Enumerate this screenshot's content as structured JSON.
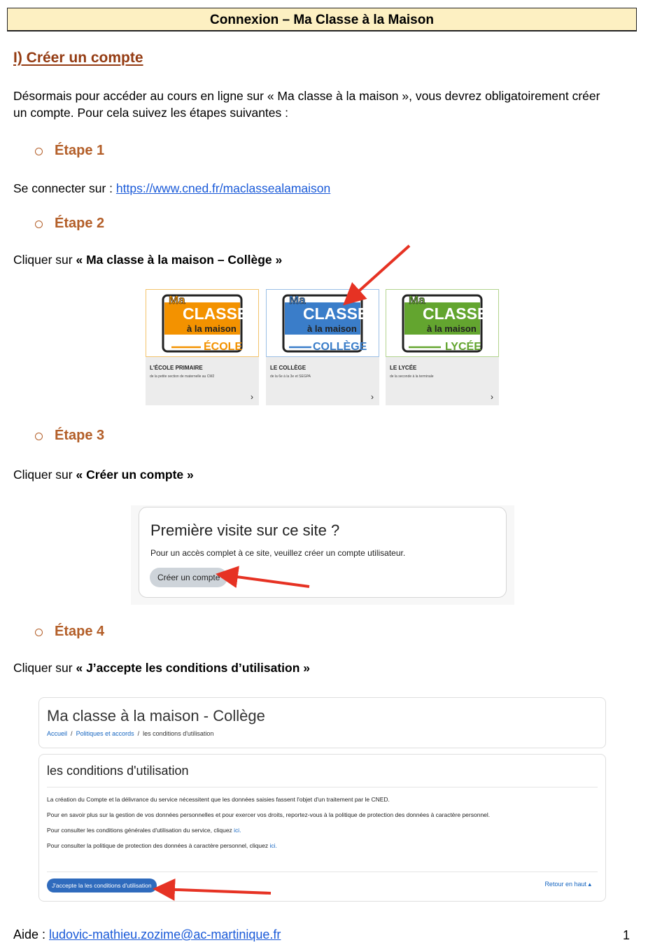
{
  "header": {
    "title": "Connexion – Ma Classe à la Maison"
  },
  "section": {
    "title": "I) Créer un compte"
  },
  "intro": {
    "line1": "Désormais pour accéder au cours en ligne sur « Ma classe à la maison », vous devrez obligatoirement créer",
    "line2": "un compte. Pour cela suivez les étapes suivantes :"
  },
  "steps": [
    {
      "label": "Étape 1"
    },
    {
      "label": "Étape 2"
    },
    {
      "label": "Étape 3"
    },
    {
      "label": "Étape 4"
    }
  ],
  "step1": {
    "prefix": "Se connecter sur : ",
    "url": "https://www.cned.fr/maclassealamaison"
  },
  "step2": {
    "prefix": "Cliquer sur ",
    "bold": "« Ma classe à la maison – Collège »"
  },
  "step3": {
    "prefix": "Cliquer sur ",
    "bold": "« Créer un compte »"
  },
  "step4": {
    "prefix": "Cliquer sur ",
    "bold": "« J’accepte les conditions d’utilisation »"
  },
  "cards": [
    {
      "logo_top": "Ma",
      "logo_mid": "CLASSE",
      "logo_small": "à la maison",
      "level": "ÉCOLE",
      "title": "L'ÉCOLE PRIMAIRE",
      "subtitle": "de la petite section de maternelle au CM2",
      "color": "#f39200",
      "border": "#f3c46c"
    },
    {
      "logo_top": "Ma",
      "logo_mid": "CLASSE",
      "logo_small": "à la maison",
      "level": "COLLÈGE",
      "title": "LE COLLÈGE",
      "subtitle": "de la 6e à la 3e et SEGPA",
      "color": "#3a7dc9",
      "border": "#9cc0e6"
    },
    {
      "logo_top": "Ma",
      "logo_mid": "CLASSE",
      "logo_small": "à la maison",
      "level": "LYCÉE",
      "title": "LE LYCÉE",
      "subtitle": "de la seconde à la terminale",
      "color": "#63a52f",
      "border": "#b3d48e"
    }
  ],
  "visit": {
    "title": "Première visite sur ce site ?",
    "text": "Pour un accès complet à ce site, veuillez créer un compte utilisateur.",
    "button": "Créer un compte"
  },
  "terms_header": {
    "title": "Ma classe à la maison - Collège",
    "crumbs": [
      "Accueil",
      "Politiques et accords",
      "les conditions d'utilisation"
    ]
  },
  "terms": {
    "title": "les conditions d'utilisation",
    "line1": "La création du Compte et la délivrance du service nécessitent que les données saisies fassent l'objet d'un traitement par le CNED.",
    "line2": "Pour en savoir plus sur la gestion de vos données personnelles et pour exercer vos droits, reportez-vous à la politique de protection des données à caractère personnel.",
    "line3": "Pour consulter les conditions générales d'utilisation du service, cliquez ",
    "line4": "Pour consulter la politique de protection des données à caractère personnel, cliquez ",
    "link": "ici.",
    "accept": "J'accepte la les conditions d'utilisation",
    "back_top": "Retour en haut ▴"
  },
  "footer": {
    "prefix": "Aide : ",
    "email": "ludovic-mathieu.zozime@ac-martinique.fr",
    "page": "1"
  },
  "colors": {
    "annotation_arrow": "#e63223",
    "step_heading": "#b35e28",
    "section_heading": "#943b12"
  }
}
